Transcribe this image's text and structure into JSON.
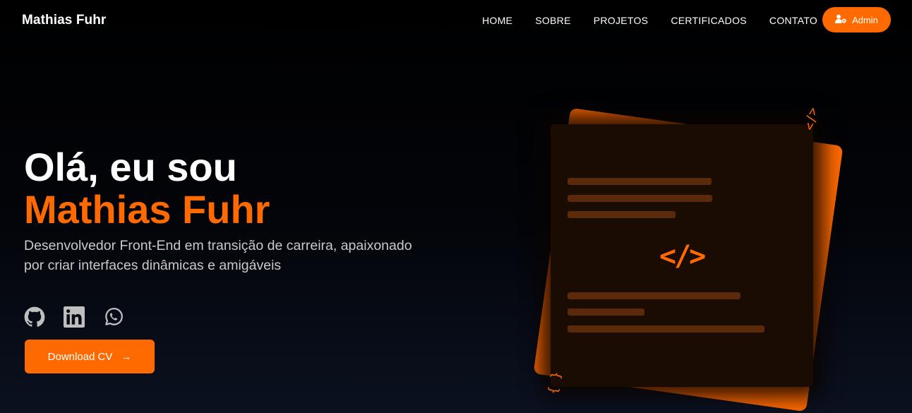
{
  "header": {
    "brand": "Mathias Fuhr",
    "nav": [
      "HOME",
      "SOBRE",
      "PROJETOS",
      "CERTIFICADOS",
      "CONTATO"
    ],
    "admin_label": "Admin"
  },
  "hero": {
    "greeting": "Olá, eu sou",
    "name": "Mathias Fuhr",
    "description": "Desenvolvedor Front-End em transição de carreira, apaixonado por criar interfaces dinâmicas e amigáveis",
    "socials": [
      "github-icon",
      "linkedin-icon",
      "whatsapp-icon"
    ],
    "cv_label": "Download CV",
    "cv_arrow": "→"
  },
  "illustration": {
    "code_symbol": "</>",
    "deco_top": "</>",
    "deco_bottom": "{ }"
  },
  "colors": {
    "accent": "#ff6a00",
    "background": "#000000",
    "text": "#ffffff",
    "muted_text": "#c9c9c9"
  }
}
